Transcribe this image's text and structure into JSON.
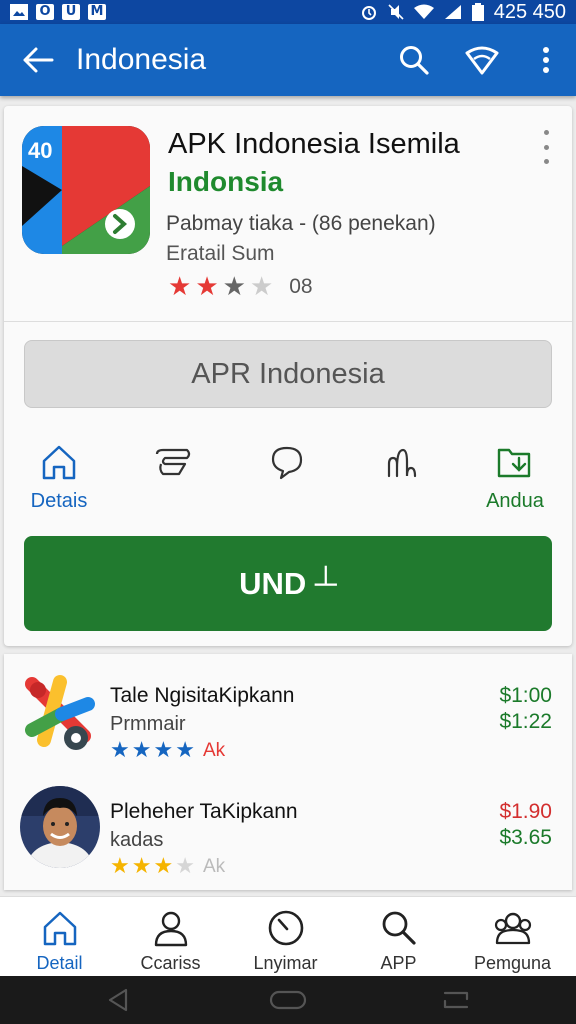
{
  "status_bar": {
    "left_icons": [
      "gallery-icon",
      "o-icon",
      "u-icon",
      "m-icon"
    ],
    "left_labels": [
      "",
      "O",
      "U",
      "M"
    ],
    "time": "425 450"
  },
  "app_bar": {
    "title": "Indonesia"
  },
  "app": {
    "icon_badge": "40",
    "name": "APK Indonesia Isemila",
    "developer": "Indonsia",
    "meta_line1": "Pabmay tiaka  -  (86 penekan)",
    "meta_line2": "Eratail Sum",
    "rating": 2.5,
    "rating_count": "08"
  },
  "secondary_button": {
    "label": "APR Indonesia"
  },
  "tabs": [
    {
      "label": "Detais",
      "icon": "home-icon"
    },
    {
      "label": "",
      "icon": "tag-icon"
    },
    {
      "label": "",
      "icon": "speech-bubble-icon"
    },
    {
      "label": "",
      "icon": "graph-icon"
    },
    {
      "label": "Andua",
      "icon": "folder-download-icon"
    }
  ],
  "primary_button": {
    "label": "UND ┴"
  },
  "list": [
    {
      "title": "Tale NgisitaKipkann",
      "subtitle": "Prmmair",
      "stars": 4,
      "star_label": "Ak",
      "price1": "$1:00",
      "price2": "$1:22",
      "colors": {
        "star": "#1565c0",
        "label": "#e53935",
        "price1": "#1b7a2a"
      }
    },
    {
      "title": "Pleheher TaKipkann",
      "subtitle": "kadas",
      "stars": 3,
      "star_label": "Ak",
      "price1": "$1.90",
      "price2": "$3.65",
      "colors": {
        "star": "#f5b400",
        "label": "#bbbbbb",
        "price1": "#d32f2f"
      }
    }
  ],
  "bottom_nav": [
    {
      "label": "Detail",
      "icon": "home-icon",
      "active": true
    },
    {
      "label": "Ccariss",
      "icon": "person-icon",
      "active": false
    },
    {
      "label": "Lnyimar",
      "icon": "clock-icon",
      "active": false
    },
    {
      "label": "APP",
      "icon": "search-icon",
      "active": false
    },
    {
      "label": "Pemguna",
      "icon": "group-icon",
      "active": false
    }
  ],
  "colors": {
    "primary": "#1565c0",
    "accent_green": "#217a2f",
    "star_red": "#e53935"
  }
}
